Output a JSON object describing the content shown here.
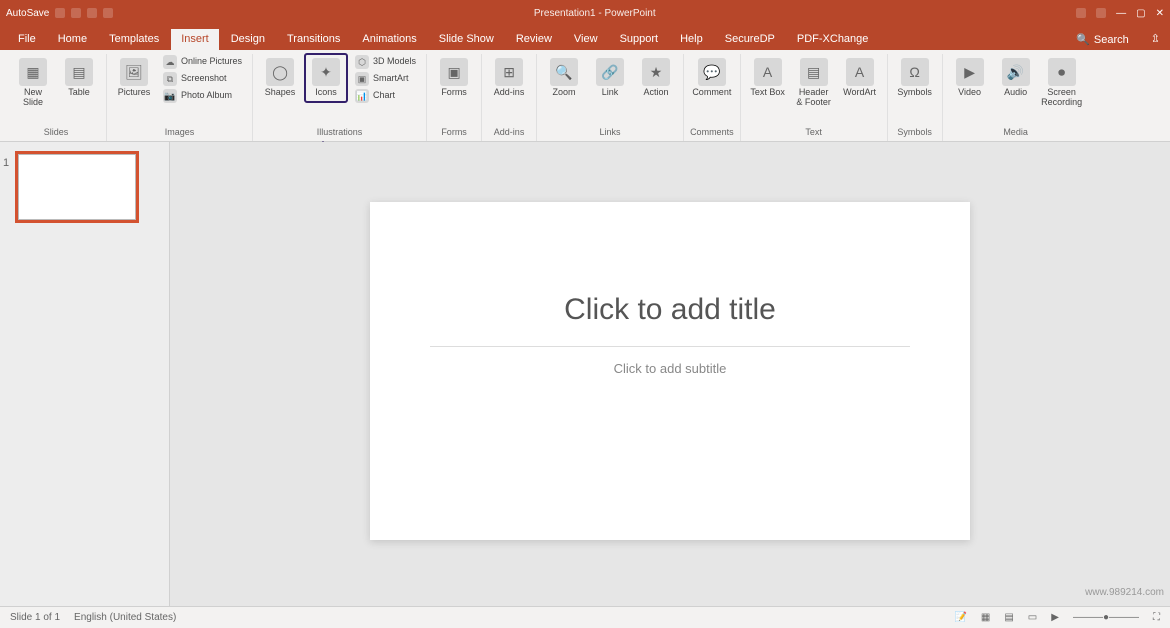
{
  "titlebar": {
    "autosave": "AutoSave",
    "doc": "Presentation1 - PowerPoint"
  },
  "tabs": {
    "file": "File",
    "home": "Home",
    "templates": "Templates",
    "insert": "Insert",
    "design": "Design",
    "transitions": "Transitions",
    "animations": "Animations",
    "slideshow": "Slide Show",
    "review": "Review",
    "view": "View",
    "support": "Support",
    "help": "Help",
    "securedp": "SecureDP",
    "pdfx": "PDF-XChange",
    "search": "Search"
  },
  "ribbon": {
    "slides": {
      "label": "Slides",
      "new": "New Slide",
      "table": "Table"
    },
    "images": {
      "label": "Images",
      "pictures": "Pictures",
      "online": "Online Pictures",
      "screenshot": "Screenshot",
      "album": "Photo Album"
    },
    "illustrations": {
      "label": "Illustrations",
      "shapes": "Shapes",
      "icons": "Icons",
      "models": "3D Models",
      "smartart": "SmartArt",
      "chart": "Chart"
    },
    "forms": {
      "label": "Forms",
      "forms": "Forms"
    },
    "addins": {
      "label": "Add-ins",
      "addins": "Add-ins"
    },
    "links": {
      "label": "Links",
      "zoom": "Zoom",
      "link": "Link",
      "action": "Action"
    },
    "comments": {
      "label": "Comments",
      "comment": "Comment"
    },
    "text": {
      "label": "Text",
      "textbox": "Text Box",
      "header": "Header & Footer",
      "wordart": "WordArt"
    },
    "symbols": {
      "label": "Symbols",
      "symbols": "Symbols"
    },
    "media": {
      "label": "Media",
      "video": "Video",
      "audio": "Audio",
      "recording": "Screen Recording"
    }
  },
  "slide": {
    "title": "Click to add title",
    "subtitle": "Click to add subtitle"
  },
  "status": {
    "slide": "Slide 1 of 1",
    "lang": "English (United States)"
  },
  "watermark": "www.989214.com",
  "thumb": {
    "num": "1"
  }
}
